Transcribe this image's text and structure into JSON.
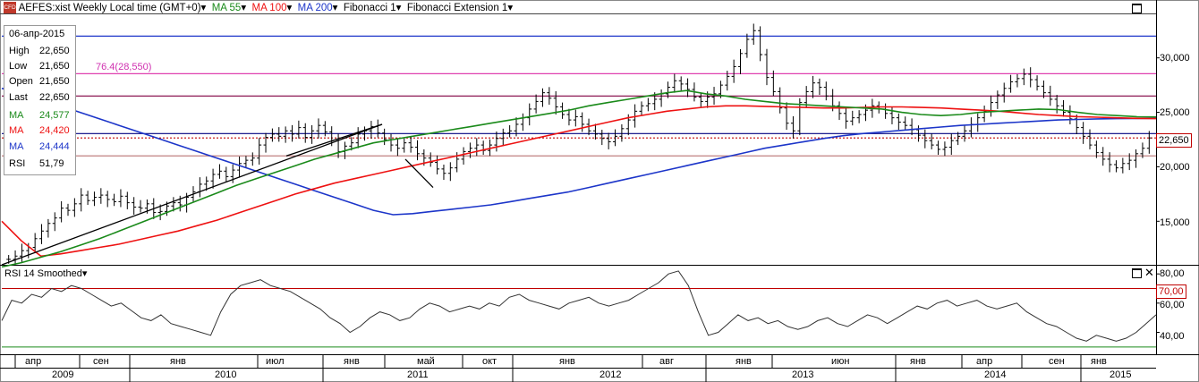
{
  "header": {
    "symbol_icon": "CFD",
    "title": "AEFES:xist Weekly Local time (GMT+0)",
    "indicators": [
      {
        "label": "MA 55",
        "color": "#1a8a1a"
      },
      {
        "label": "MA 100",
        "color": "#e11"
      },
      {
        "label": "MA 200",
        "color": "#1c35c9"
      },
      {
        "label": "Fibonacci 1",
        "color": "#000"
      },
      {
        "label": "Fibonacci Extension 1",
        "color": "#000"
      }
    ],
    "dropdown_glyph": "▾"
  },
  "ohlc_box": {
    "date": "06-апр-2015",
    "rows": [
      {
        "label": "High",
        "value": "22,650",
        "color": "#000"
      },
      {
        "label": "Low",
        "value": "21,650",
        "color": "#000"
      },
      {
        "label": "Open",
        "value": "21,650",
        "color": "#000"
      },
      {
        "label": "Last",
        "value": "22,650",
        "color": "#000"
      },
      {
        "label": "MA",
        "value": "24,577",
        "color": "#1a8a1a"
      },
      {
        "label": "MA",
        "value": "24,420",
        "color": "#e11"
      },
      {
        "label": "MA",
        "value": "24,444",
        "color": "#1c35c9"
      },
      {
        "label": "RSI",
        "value": "51,79",
        "color": "#000"
      }
    ]
  },
  "fib_label": "76.4(28,550)",
  "last_price_tag": "22,650",
  "rsi_panel": {
    "title": "RSI 14 Smoothed",
    "level_tag": "70,00",
    "y_ticks": [
      "80,00",
      "60,00",
      "40,00"
    ]
  },
  "x_axis": {
    "months": [
      "апр",
      "сен",
      "янв",
      "июл",
      "янв",
      "май",
      "окт",
      "янв",
      "авг",
      "янв",
      "июн",
      "янв",
      "апр",
      "сен",
      "янв"
    ],
    "years": [
      "2009",
      "2010",
      "2011",
      "2012",
      "2013",
      "2014",
      "2015"
    ]
  },
  "chart_data": {
    "type": "ohlc",
    "price_y_ticks": [
      15000,
      20000,
      25000,
      30000
    ],
    "price_y_tick_labels": [
      "15,000",
      "20,000",
      "25,000",
      "30,000"
    ],
    "horizontal_levels": [
      {
        "value": 32000,
        "color": "#1c35c9"
      },
      {
        "value": 28550,
        "color": "#e040b0"
      },
      {
        "value": 26500,
        "color": "#800040"
      },
      {
        "value": 23050,
        "color": "#000080"
      },
      {
        "value": 22650,
        "color": "#c00000",
        "dotted": true
      },
      {
        "value": 21000,
        "color": "#c08080"
      }
    ],
    "close_series": [
      11500,
      11800,
      12300,
      12600,
      13400,
      14100,
      14800,
      15300,
      16200,
      16000,
      16600,
      17400,
      16900,
      17200,
      17400,
      17000,
      16800,
      17300,
      16700,
      16300,
      16200,
      16600,
      15800,
      15900,
      16400,
      16700,
      16500,
      17200,
      17700,
      18400,
      18700,
      19300,
      19600,
      19100,
      19700,
      20300,
      20600,
      20800,
      22000,
      22700,
      23000,
      22800,
      23300,
      23000,
      23600,
      22700,
      23300,
      23800,
      23200,
      22400,
      21400,
      21900,
      22200,
      23000,
      23300,
      23700,
      23100,
      22500,
      22000,
      21700,
      22200,
      21800,
      21200,
      20800,
      20400,
      19800,
      19400,
      19900,
      20700,
      21400,
      21700,
      22000,
      21500,
      22000,
      22600,
      23100,
      23300,
      23900,
      24500,
      25300,
      26000,
      26800,
      26300,
      25500,
      24800,
      24300,
      24600,
      23900,
      23300,
      23000,
      22600,
      22300,
      22800,
      23500,
      24300,
      25100,
      25600,
      25800,
      26200,
      26700,
      27300,
      27900,
      27600,
      27100,
      26400,
      26000,
      26400,
      26700,
      27500,
      28300,
      29200,
      30400,
      31700,
      32500,
      30300,
      28200,
      26900,
      25400,
      24000,
      23300,
      25900,
      26900,
      27700,
      27300,
      26500,
      25600,
      24900,
      24200,
      24500,
      24800,
      25200,
      25600,
      25300,
      24900,
      24500,
      24100,
      23800,
      23400,
      22900,
      22400,
      22000,
      21600,
      21800,
      22400,
      22800,
      23300,
      23900,
      24500,
      25100,
      25900,
      26600,
      27200,
      27800,
      28100,
      28500,
      28000,
      27400,
      26800,
      26200,
      25600,
      25000,
      24400,
      23600,
      22800,
      22000,
      21300,
      20700,
      20200,
      19900,
      20300,
      20600,
      21200,
      21700,
      22650
    ],
    "ma55_series": [
      10800,
      11200,
      11700,
      12200,
      12800,
      13400,
      14100,
      14800,
      15500,
      16200,
      16900,
      17600,
      18300,
      18900,
      19500,
      20100,
      20700,
      21200,
      21700,
      22200,
      22500,
      22800,
      23100,
      23400,
      23700,
      24000,
      24300,
      24600,
      24900,
      25200,
      25600,
      25900,
      26200,
      26500,
      26800,
      27000,
      26700,
      26500,
      26200,
      26000,
      25800,
      25700,
      25600,
      25500,
      25400,
      25300,
      25000,
      24800,
      24700,
      24800,
      25000,
      25100,
      25200,
      25300,
      25250,
      25000,
      24800,
      24700,
      24600,
      24577
    ],
    "ma100_series": [
      15000,
      13200,
      11800,
      12000,
      12300,
      12600,
      12900,
      13300,
      13700,
      14100,
      14600,
      15100,
      15700,
      16300,
      16900,
      17500,
      18000,
      18500,
      18900,
      19300,
      19700,
      20100,
      20500,
      20900,
      21300,
      21700,
      22100,
      22500,
      22900,
      23300,
      23700,
      24100,
      24500,
      24800,
      25100,
      25300,
      25500,
      25600,
      25600,
      25550,
      25500,
      25450,
      25400,
      25400,
      25450,
      25500,
      25500,
      25450,
      25400,
      25300,
      25200,
      25100,
      24950,
      24800,
      24700,
      24600,
      24550,
      24500,
      24450,
      24420
    ],
    "ma200_series": [
      27200,
      26800,
      26200,
      25600,
      25000,
      24400,
      23800,
      23200,
      22600,
      22000,
      21400,
      20800,
      20200,
      19600,
      19000,
      18400,
      17800,
      17200,
      16600,
      16000,
      15600,
      15700,
      15900,
      16100,
      16300,
      16500,
      16800,
      17100,
      17400,
      17700,
      18100,
      18500,
      18900,
      19300,
      19700,
      20100,
      20500,
      20900,
      21300,
      21700,
      22000,
      22300,
      22600,
      22850,
      23050,
      23200,
      23350,
      23500,
      23650,
      23800,
      23900,
      24000,
      24100,
      24200,
      24300,
      24350,
      24400,
      24420,
      24440,
      24444
    ],
    "rsi_series": [
      48,
      62,
      60,
      66,
      64,
      70,
      68,
      72,
      70,
      66,
      62,
      58,
      60,
      55,
      50,
      48,
      52,
      46,
      44,
      42,
      40,
      38,
      54,
      66,
      72,
      74,
      76,
      72,
      70,
      68,
      64,
      60,
      56,
      50,
      46,
      40,
      44,
      50,
      54,
      52,
      48,
      50,
      56,
      60,
      58,
      54,
      56,
      58,
      56,
      60,
      58,
      64,
      66,
      62,
      60,
      58,
      56,
      60,
      62,
      64,
      60,
      58,
      60,
      62,
      66,
      70,
      74,
      80,
      82,
      72,
      54,
      38,
      40,
      46,
      52,
      48,
      50,
      46,
      48,
      44,
      42,
      44,
      48,
      50,
      46,
      44,
      48,
      52,
      50,
      46,
      50,
      54,
      58,
      56,
      60,
      62,
      58,
      60,
      62,
      58,
      56,
      58,
      60,
      54,
      50,
      46,
      44,
      40,
      36,
      34,
      38,
      36,
      34,
      36,
      40,
      46,
      52
    ],
    "rsi_levels": [
      70,
      30
    ]
  }
}
